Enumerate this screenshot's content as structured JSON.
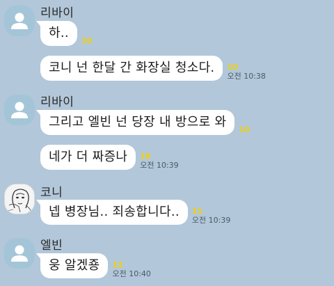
{
  "messages_view": {
    "groups": [
      {
        "sender": "리바이",
        "avatar": "default-profile-icon",
        "messages": [
          {
            "text": "하..",
            "unread": "10",
            "time": ""
          },
          {
            "text": "코니 넌 한달 간 화장실 청소다.",
            "unread": "10",
            "time": "오전 10:38"
          }
        ]
      },
      {
        "sender": "리바이",
        "avatar": "default-profile-icon",
        "messages": [
          {
            "text": "그리고 엘빈 넌 당장 내 방으로 와",
            "unread": "10",
            "time": ""
          },
          {
            "text": "네가 더 짜증나",
            "unread": "10",
            "time": "오전 10:39"
          }
        ]
      },
      {
        "sender": "코니",
        "avatar": "sketch-portrait-photo",
        "messages": [
          {
            "text": "넵 병장님.. 죄송합니다..",
            "unread": "11",
            "time": "오전 10:39"
          }
        ]
      },
      {
        "sender": "엘빈",
        "avatar": "default-profile-icon",
        "messages": [
          {
            "text": "웅 알겠죵",
            "unread": "12",
            "time": "오전 10:40"
          }
        ]
      }
    ]
  },
  "colors": {
    "background": "#b2c7d9",
    "bubble": "#ffffff",
    "unread": "#f5d000",
    "default_avatar": "#a4c5d8"
  }
}
